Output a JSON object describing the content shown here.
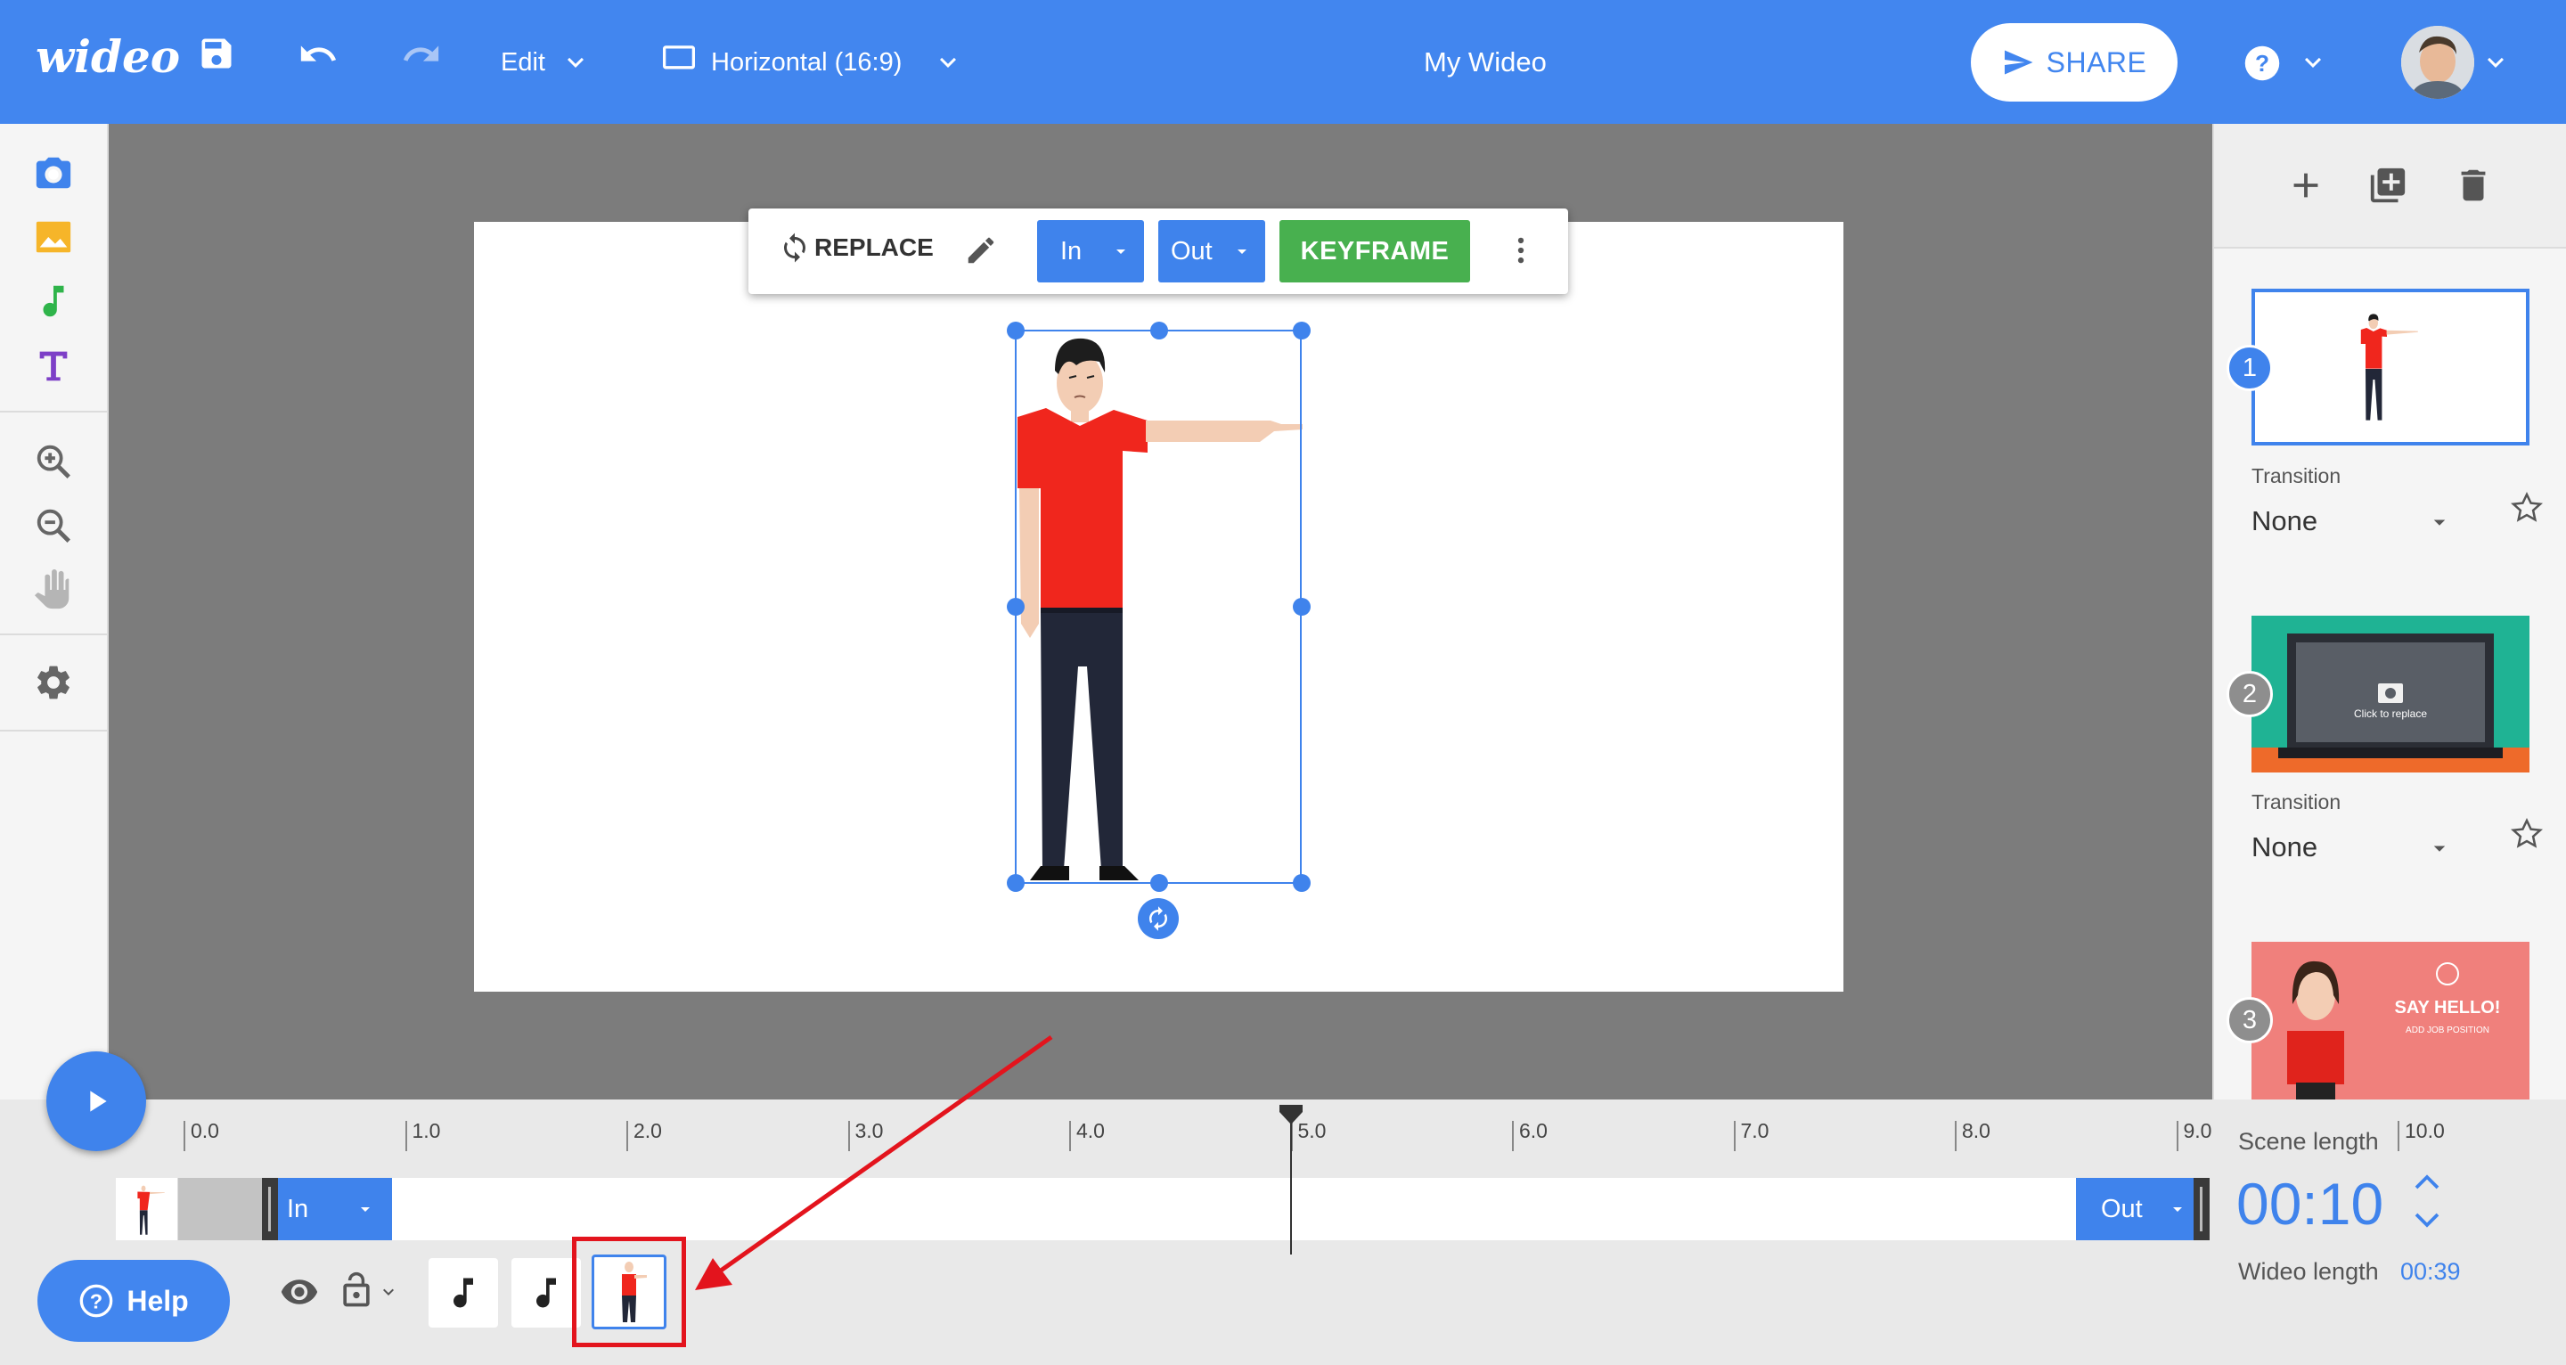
{
  "header": {
    "logo_text": "wideo",
    "edit_menu_label": "Edit",
    "format_label": "Horizontal (16:9)",
    "title": "My Wideo",
    "share_label": "SHARE",
    "colors": {
      "bar": "#4286ef",
      "share_text": "#4286ef"
    }
  },
  "sidebar": {
    "icons": [
      "camera-icon",
      "image-icon",
      "music-icon",
      "text-icon",
      "zoom-in-icon",
      "zoom-out-icon",
      "hand-icon",
      "settings-icon"
    ]
  },
  "object_toolbar": {
    "replace_label": "REPLACE",
    "in_label": "In",
    "out_label": "Out",
    "keyframe_label": "KEYFRAME",
    "colors": {
      "in_out": "#3f83ec",
      "keyframe": "#48b04f"
    }
  },
  "scenes": {
    "items": [
      {
        "number": "1",
        "transition_label": "Transition",
        "transition_value": "None",
        "selected": true
      },
      {
        "number": "2",
        "transition_label": "Transition",
        "transition_value": "None",
        "thumb_caption": "Click to replace"
      },
      {
        "number": "3",
        "thumb_title": "SAY HELLO!",
        "thumb_sub": "ADD JOB POSITION"
      }
    ]
  },
  "timeline": {
    "ticks": [
      "0.0",
      "1.0",
      "2.0",
      "3.0",
      "4.0",
      "5.0",
      "6.0",
      "7.0",
      "8.0",
      "9.0",
      "10.0"
    ],
    "playhead_position": 5.0,
    "in_label": "In",
    "out_label": "Out",
    "scene_length_label": "Scene length",
    "scene_length_value": "00:10",
    "wideo_length_label": "Wideo length",
    "wideo_length_value": "00:39",
    "help_label": "Help"
  }
}
